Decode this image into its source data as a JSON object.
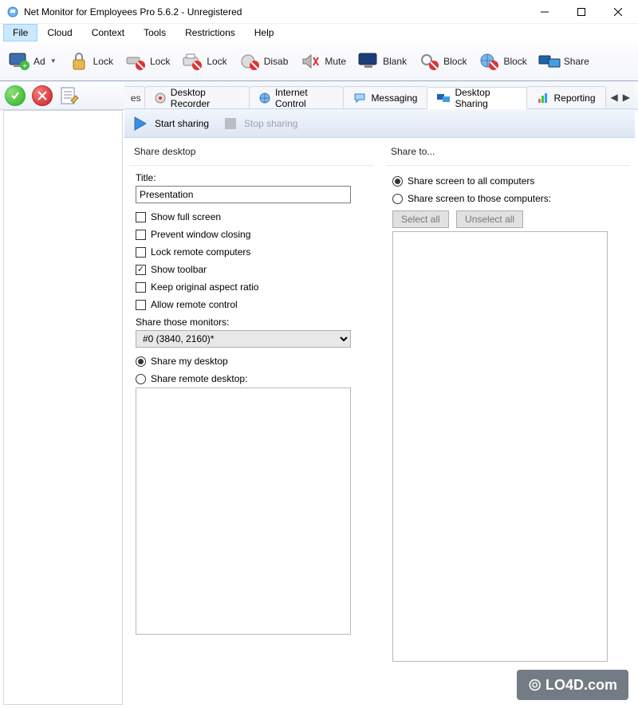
{
  "window": {
    "title": "Net Monitor for Employees Pro 5.6.2 - Unregistered"
  },
  "menubar": [
    "File",
    "Cloud",
    "Context",
    "Tools",
    "Restrictions",
    "Help"
  ],
  "menubar_active_index": 0,
  "toolbar": [
    {
      "label": "Ad",
      "has_caret": true,
      "icon": "monitor-add"
    },
    {
      "label": "Lock",
      "icon": "padlock"
    },
    {
      "label": "Lock",
      "icon": "usb-block"
    },
    {
      "label": "Lock",
      "icon": "printer-block"
    },
    {
      "label": "Disab",
      "icon": "disable"
    },
    {
      "label": "Mute",
      "icon": "mute"
    },
    {
      "label": "Blank",
      "icon": "blank-screen"
    },
    {
      "label": "Block",
      "icon": "search-block"
    },
    {
      "label": "Block",
      "icon": "globe-block"
    },
    {
      "label": "Share",
      "icon": "share-screen"
    }
  ],
  "tabs": {
    "partial_left_label": "es",
    "items": [
      {
        "label": "Desktop Recorder",
        "icon": "recorder"
      },
      {
        "label": "Internet Control",
        "icon": "globe"
      },
      {
        "label": "Messaging",
        "icon": "chat"
      },
      {
        "label": "Desktop Sharing",
        "icon": "sharing",
        "active": true
      },
      {
        "label": "Reporting",
        "icon": "chart"
      }
    ]
  },
  "actions": {
    "start": "Start sharing",
    "stop": "Stop sharing"
  },
  "share_desktop": {
    "panel_title": "Share desktop",
    "title_label": "Title:",
    "title_value": "Presentation",
    "checkboxes": [
      {
        "label": "Show full screen",
        "checked": false
      },
      {
        "label": "Prevent window closing",
        "checked": false
      },
      {
        "label": "Lock remote computers",
        "checked": false
      },
      {
        "label": "Show toolbar",
        "checked": true
      },
      {
        "label": "Keep original aspect ratio",
        "checked": false
      },
      {
        "label": "Allow remote control",
        "checked": false
      }
    ],
    "monitors_label": "Share those monitors:",
    "monitor_selected": "#0 (3840, 2160)*",
    "source_radios": [
      {
        "label": "Share my desktop",
        "selected": true
      },
      {
        "label": "Share remote desktop:",
        "selected": false
      }
    ]
  },
  "share_to": {
    "panel_title": "Share to...",
    "radios": [
      {
        "label": "Share screen to all computers",
        "selected": true
      },
      {
        "label": "Share screen to those computers:",
        "selected": false
      }
    ],
    "select_all": "Select all",
    "unselect_all": "Unselect all"
  },
  "watermark": "LO4D.com"
}
